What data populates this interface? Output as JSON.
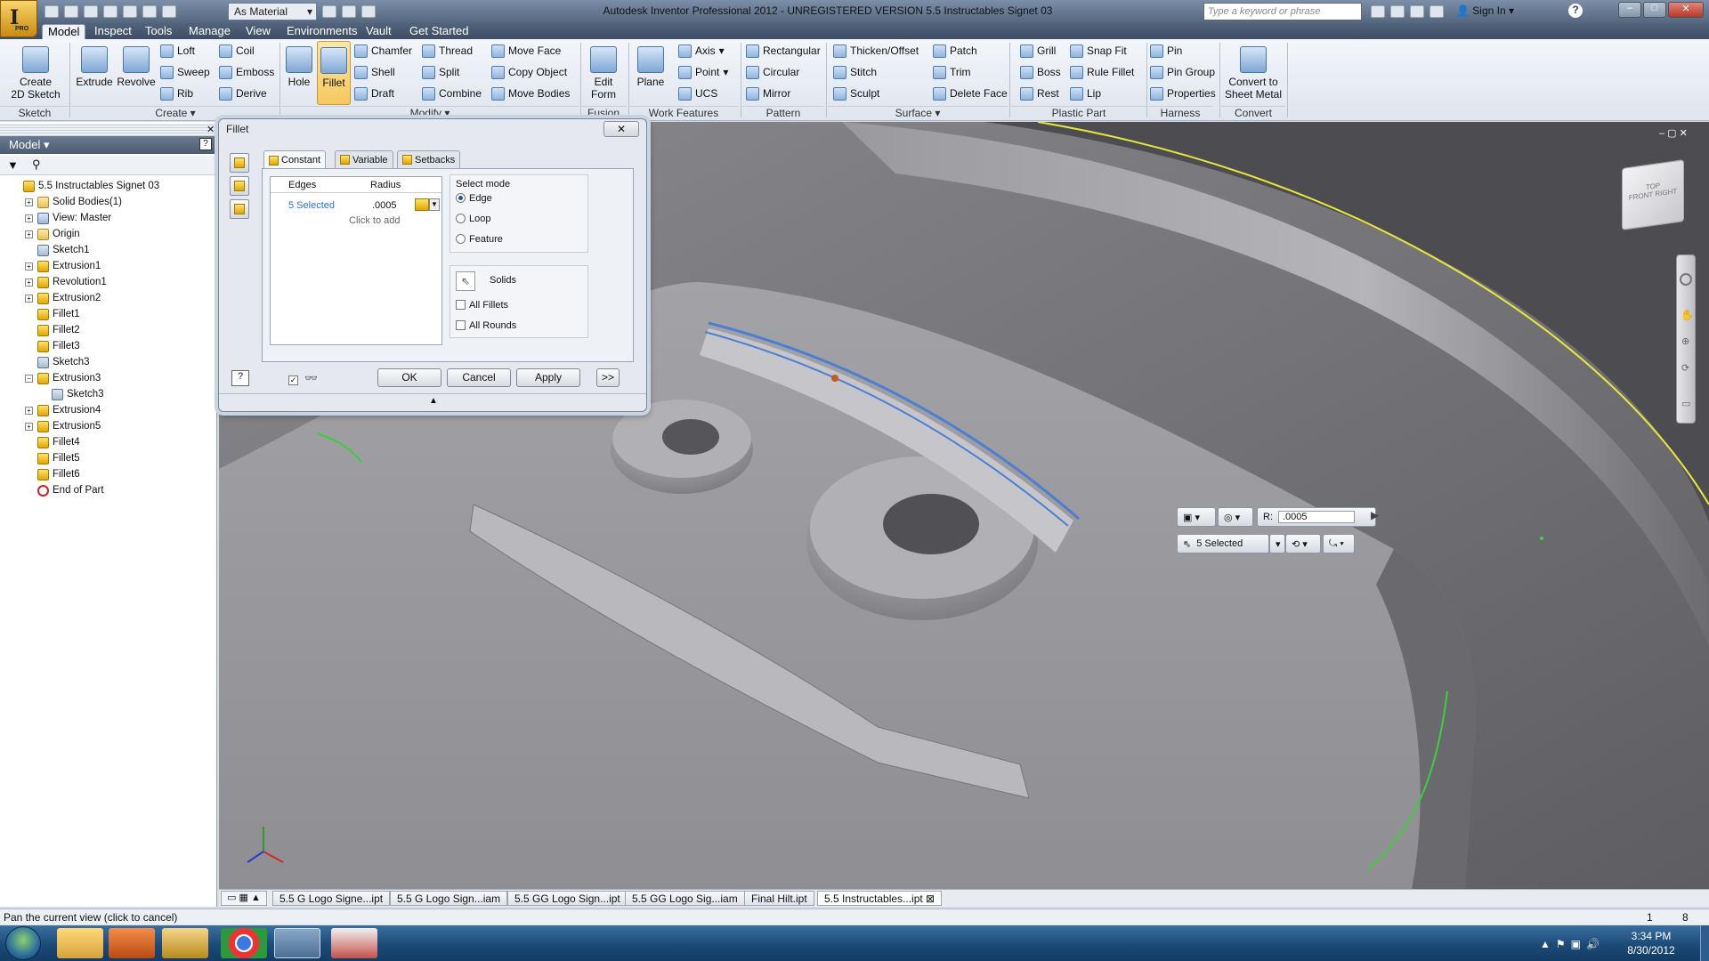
{
  "title_bar": {
    "material": "As Material",
    "title": "Autodesk Inventor Professional 2012 - UNREGISTERED VERSION   5.5 Instructables Signet 03",
    "search_placeholder": "Type a keyword or phrase",
    "sign_in": "Sign In",
    "app_badge": "PRO"
  },
  "menu_tabs": [
    "Model",
    "Inspect",
    "Tools",
    "Manage",
    "View",
    "Environments",
    "Vault",
    "Get Started"
  ],
  "ribbon": {
    "sketch": {
      "button": "Create\n2D Sketch",
      "group": "Sketch"
    },
    "create": {
      "big": [
        "Extrude",
        "Revolve"
      ],
      "small": [
        "Loft",
        "Sweep",
        "Rib",
        "Coil",
        "Emboss",
        "Derive"
      ],
      "group": "Create ▾"
    },
    "modify": {
      "big": [
        "Hole",
        "Fillet"
      ],
      "small": [
        "Chamfer",
        "Shell",
        "Draft",
        "Thread",
        "Split",
        "Combine",
        "Move Face",
        "Copy Object",
        "Move Bodies"
      ],
      "group": "Modify ▾"
    },
    "fusion": {
      "button": "Edit\nForm",
      "group": "Fusion"
    },
    "work_features": {
      "big": "Plane",
      "small": [
        "Axis",
        "Point",
        "UCS"
      ],
      "group": "Work Features"
    },
    "pattern": {
      "small": [
        "Rectangular",
        "Circular",
        "Mirror"
      ],
      "group": "Pattern"
    },
    "surface": {
      "small": [
        "Thicken/Offset",
        "Stitch",
        "Sculpt",
        "Patch",
        "Trim",
        "Delete Face"
      ],
      "group": "Surface ▾"
    },
    "plastic_part": {
      "small": [
        "Grill",
        "Boss",
        "Rest",
        "Snap Fit",
        "Rule Fillet",
        "Lip"
      ],
      "group": "Plastic Part"
    },
    "harness": {
      "small": [
        "Pin",
        "Pin Group",
        "Properties"
      ],
      "group": "Harness"
    },
    "convert": {
      "button": "Convert to\nSheet Metal",
      "group": "Convert"
    }
  },
  "browser": {
    "header": "Model ▾",
    "tree": [
      {
        "label": "5.5 Instructables Signet 03",
        "indent": 0,
        "icon": "part",
        "exp": ""
      },
      {
        "label": "Solid Bodies(1)",
        "indent": 1,
        "icon": "folder",
        "exp": "+"
      },
      {
        "label": "View: Master",
        "indent": 1,
        "icon": "eye",
        "exp": "+"
      },
      {
        "label": "Origin",
        "indent": 1,
        "icon": "folder",
        "exp": "+"
      },
      {
        "label": "Sketch1",
        "indent": 1,
        "icon": "sketch",
        "exp": ""
      },
      {
        "label": "Extrusion1",
        "indent": 1,
        "icon": "feature",
        "exp": "+"
      },
      {
        "label": "Revolution1",
        "indent": 1,
        "icon": "feature",
        "exp": "+"
      },
      {
        "label": "Extrusion2",
        "indent": 1,
        "icon": "feature",
        "exp": "+"
      },
      {
        "label": "Fillet1",
        "indent": 1,
        "icon": "feature",
        "exp": ""
      },
      {
        "label": "Fillet2",
        "indent": 1,
        "icon": "feature",
        "exp": ""
      },
      {
        "label": "Fillet3",
        "indent": 1,
        "icon": "feature",
        "exp": ""
      },
      {
        "label": "Sketch3",
        "indent": 1,
        "icon": "sketch",
        "exp": ""
      },
      {
        "label": "Extrusion3",
        "indent": 1,
        "icon": "feature",
        "exp": "−"
      },
      {
        "label": "Sketch3",
        "indent": 2,
        "icon": "sketch",
        "exp": ""
      },
      {
        "label": "Extrusion4",
        "indent": 1,
        "icon": "feature",
        "exp": "+"
      },
      {
        "label": "Extrusion5",
        "indent": 1,
        "icon": "feature",
        "exp": "+"
      },
      {
        "label": "Fillet4",
        "indent": 1,
        "icon": "feature",
        "exp": ""
      },
      {
        "label": "Fillet5",
        "indent": 1,
        "icon": "feature",
        "exp": ""
      },
      {
        "label": "Fillet6",
        "indent": 1,
        "icon": "feature",
        "exp": ""
      },
      {
        "label": "End of Part",
        "indent": 1,
        "icon": "end",
        "exp": ""
      }
    ]
  },
  "fillet_dialog": {
    "title": "Fillet",
    "close": "✕",
    "tabs": [
      "Constant",
      "Variable",
      "Setbacks"
    ],
    "col_edges": "Edges",
    "col_radius": "Radius",
    "row_edges": "5 Selected",
    "row_radius": ".0005",
    "click_to_add": "Click to add",
    "select_mode_title": "Select mode",
    "modes": [
      "Edge",
      "Loop",
      "Feature"
    ],
    "solids": "Solids",
    "all_fillets": "All Fillets",
    "all_rounds": "All Rounds",
    "ok": "OK",
    "cancel": "Cancel",
    "apply": "Apply",
    "more": ">>"
  },
  "minitoolbar": {
    "radius_label": "R:",
    "radius_value": ".0005",
    "selected": "5 Selected"
  },
  "view_cube": {
    "top": "TOP",
    "front": "FRONT",
    "right": "RIGHT"
  },
  "doc_tabs": [
    "5.5 G Logo Signe...ipt",
    "5.5 G Logo Sign...iam",
    "5.5 GG Logo Sign...ipt",
    "5.5 GG Logo Sig...iam",
    "Final Hilt.ipt",
    "5.5 Instructables...ipt ⊠"
  ],
  "status": {
    "text": "Pan the current view (click to cancel)",
    "n1": "1",
    "n2": "8"
  },
  "clock": {
    "time": "3:34 PM",
    "date": "8/30/2012"
  }
}
